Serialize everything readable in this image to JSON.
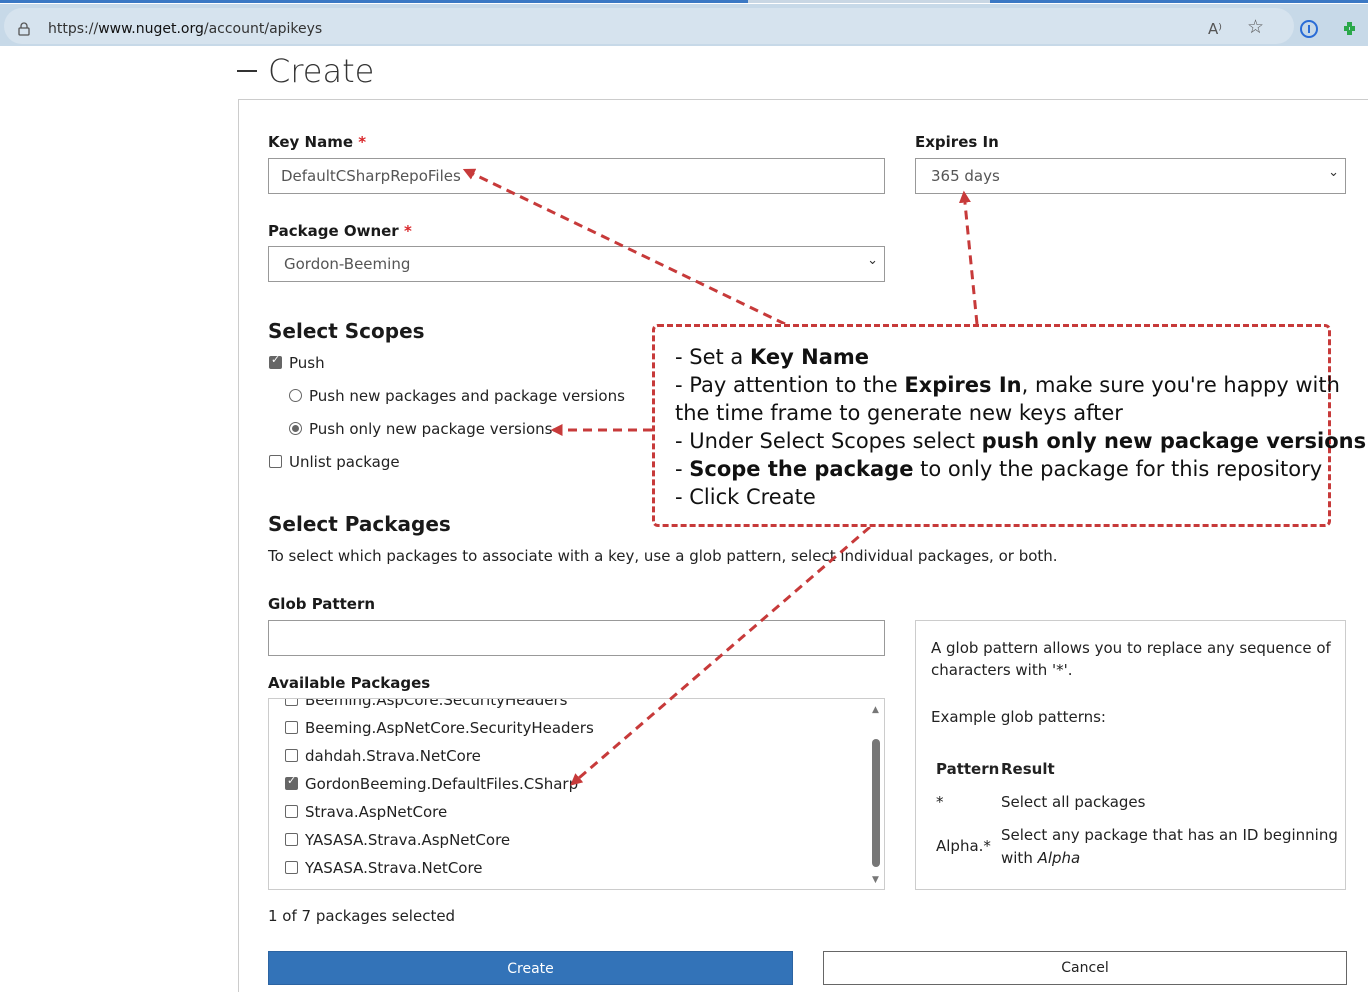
{
  "browser": {
    "url_prefix": "https://",
    "url_host": "www.nuget.org",
    "url_path": "/account/apikeys",
    "read_aloud_icon": "A⁾",
    "favorite_icon": "☆"
  },
  "page": {
    "title": "Create"
  },
  "form": {
    "key_name_label": "Key Name",
    "key_name_value": "DefaultCSharpRepoFiles",
    "required_mark": "*",
    "expires_label": "Expires In",
    "expires_value": "365 days",
    "owner_label": "Package Owner",
    "owner_value": "Gordon-Beeming",
    "chevron": "⌄"
  },
  "scopes": {
    "heading": "Select Scopes",
    "push_label": "Push",
    "push_checked": true,
    "push_new_label": "Push new packages and package versions",
    "push_only_label": "Push only new package versions",
    "unlist_label": "Unlist package"
  },
  "packages": {
    "heading": "Select Packages",
    "description": "To select which packages to associate with a key, use a glob pattern, select individual packages, or both.",
    "glob_label": "Glob Pattern",
    "glob_value": "",
    "available_label": "Available Packages",
    "items": [
      {
        "label": "Beeming.AspCore.SecurityHeaders",
        "checked": false
      },
      {
        "label": "Beeming.AspNetCore.SecurityHeaders",
        "checked": false
      },
      {
        "label": "dahdah.Strava.NetCore",
        "checked": false
      },
      {
        "label": "GordonBeeming.DefaultFiles.CSharp",
        "checked": true
      },
      {
        "label": "Strava.AspNetCore",
        "checked": false
      },
      {
        "label": "YASASA.Strava.AspNetCore",
        "checked": false
      },
      {
        "label": "YASASA.Strava.NetCore",
        "checked": false
      }
    ],
    "selected_count_text": "1 of 7 packages selected"
  },
  "glob_help": {
    "line1": "A glob pattern allows you to replace any sequence of",
    "line2": "characters with '*'.",
    "examples_heading": "Example glob patterns:",
    "col_pattern": "Pattern",
    "col_result": "Result",
    "row1_pattern": "*",
    "row1_result": "Select all packages",
    "row2_pattern": "Alpha.*",
    "row2_result_line1": "Select any package that has an ID beginning",
    "row2_result_prefix": "with ",
    "row2_result_em": "Alpha"
  },
  "buttons": {
    "create": "Create",
    "cancel": "Cancel"
  },
  "callout": {
    "l1_a": "- Set a ",
    "l1_b": "Key Name",
    "l2_a": "- Pay attention to the ",
    "l2_b": "Expires In",
    "l2_c": ", make sure you're happy with",
    "l3": "the time frame to generate new keys after",
    "l4_a": "- Under Select Scopes select ",
    "l4_b": "push only new package versions",
    "l5_a": "- ",
    "l5_b": "Scope the package",
    "l5_c": " to only the package for this repository",
    "l6": "- Click Create"
  },
  "colors": {
    "accent": "#3373b8",
    "annotation": "#c73a3a",
    "required": "#d9262a"
  }
}
